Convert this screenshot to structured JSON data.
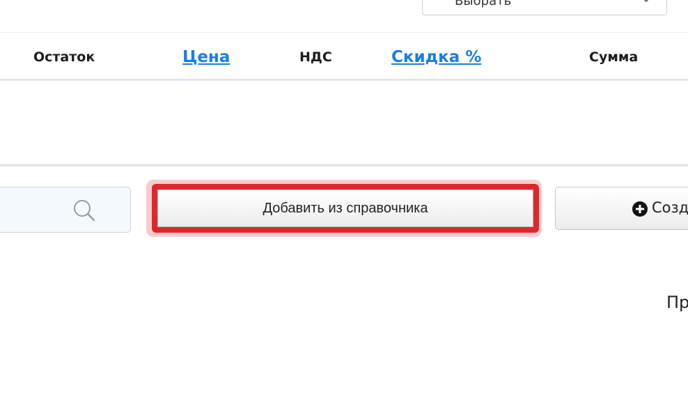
{
  "top_select": {
    "value": "Выбрать"
  },
  "table": {
    "columns": [
      {
        "label": "Остаток",
        "sortable": false
      },
      {
        "label": "Цена",
        "sortable": true
      },
      {
        "label": "НДС",
        "sortable": false
      },
      {
        "label": "Скидка %",
        "sortable": true
      },
      {
        "label": "Сумма",
        "sortable": false
      }
    ]
  },
  "actions": {
    "add_from_directory_label": "Добавить из справочника",
    "create_label": "Созд"
  },
  "footer": {
    "partial_text": "Пр"
  },
  "colors": {
    "link": "#1a7fe0",
    "highlight": "#e0262d"
  }
}
